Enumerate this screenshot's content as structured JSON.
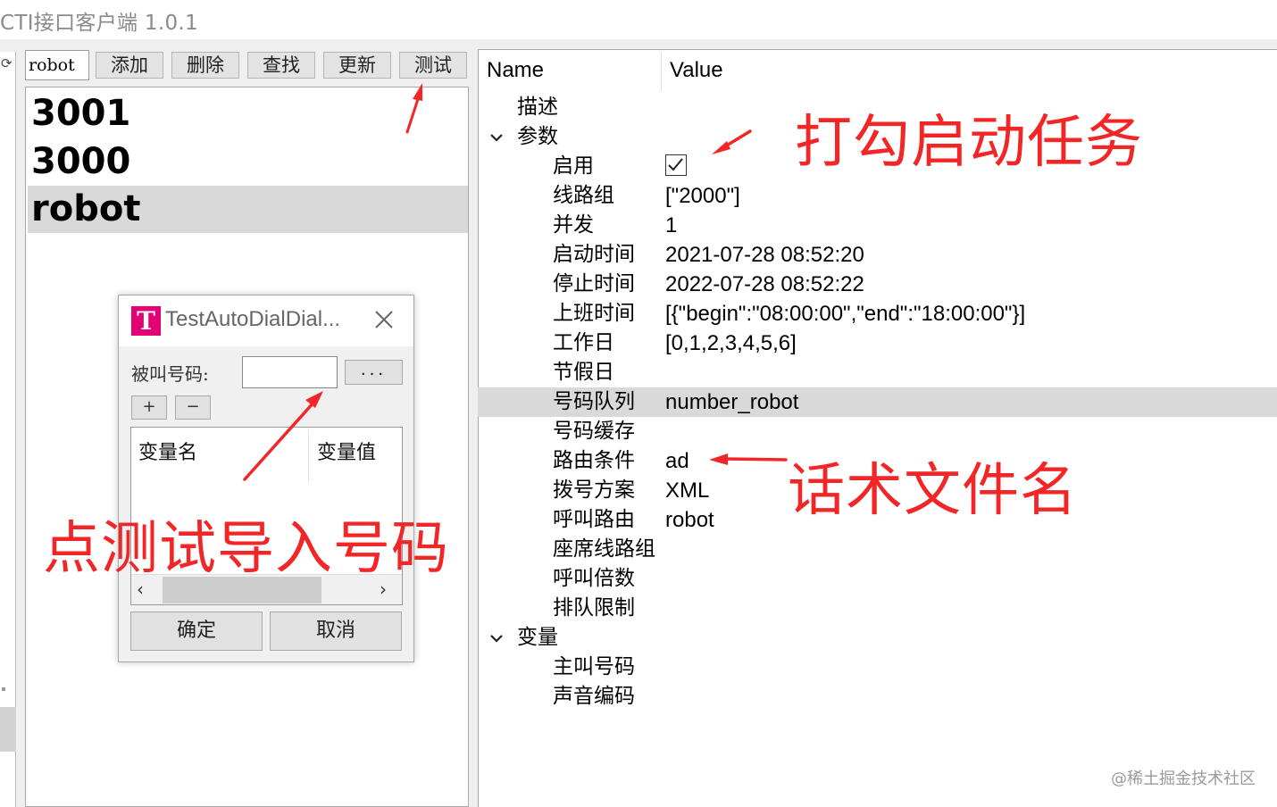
{
  "app": {
    "title": "CTI接口客户端 1.0.1"
  },
  "toolbar": {
    "search_value": "robot",
    "buttons": [
      "添加",
      "删除",
      "查找",
      "更新",
      "测试"
    ]
  },
  "list": {
    "items": [
      "3001",
      "3000",
      "robot"
    ],
    "selected": "robot"
  },
  "tree": {
    "headers": {
      "name": "Name",
      "value": "Value"
    },
    "rows": [
      {
        "name": "描述",
        "value": ""
      },
      {
        "name": "参数",
        "value": ""
      },
      {
        "name": "启用",
        "value": "",
        "checked": true
      },
      {
        "name": "线路组",
        "value": "[\"2000\"]"
      },
      {
        "name": "并发",
        "value": "1"
      },
      {
        "name": "启动时间",
        "value": "2021-07-28 08:52:20"
      },
      {
        "name": "停止时间",
        "value": "2022-07-28 08:52:22"
      },
      {
        "name": "上班时间",
        "value": "[{\"begin\":\"08:00:00\",\"end\":\"18:00:00\"}]"
      },
      {
        "name": "工作日",
        "value": "[0,1,2,3,4,5,6]"
      },
      {
        "name": "节假日",
        "value": ""
      },
      {
        "name": "号码队列",
        "value": "number_robot"
      },
      {
        "name": "号码缓存",
        "value": ""
      },
      {
        "name": "路由条件",
        "value": "ad"
      },
      {
        "name": "拨号方案",
        "value": "XML"
      },
      {
        "name": "呼叫路由",
        "value": "robot"
      },
      {
        "name": "座席线路组",
        "value": ""
      },
      {
        "name": "呼叫倍数",
        "value": ""
      },
      {
        "name": "排队限制",
        "value": ""
      },
      {
        "name": "变量",
        "value": ""
      },
      {
        "name": "主叫号码",
        "value": ""
      },
      {
        "name": "声音编码",
        "value": ""
      }
    ],
    "selected_row": "号码队列"
  },
  "dialog": {
    "logo_letter": "T",
    "title": "TestAutoDialDial...",
    "callee_label": "被叫号码:",
    "callee_value": "",
    "browse_label": "...",
    "add_label": "+",
    "remove_label": "−",
    "table_headers": [
      "变量名",
      "变量值"
    ],
    "ok_label": "确定",
    "cancel_label": "取消"
  },
  "annotations": {
    "checkbox_note": "打勾启动任务",
    "script_note": "话术文件名",
    "test_note": "点测试导入号码",
    "color": "#f22626"
  },
  "watermark": "@稀土掘金技术社区",
  "icons": [
    "refresh-icon",
    "chevron-down-icon",
    "close-icon",
    "checkmark-icon",
    "chevron-left-icon",
    "chevron-right-icon"
  ]
}
